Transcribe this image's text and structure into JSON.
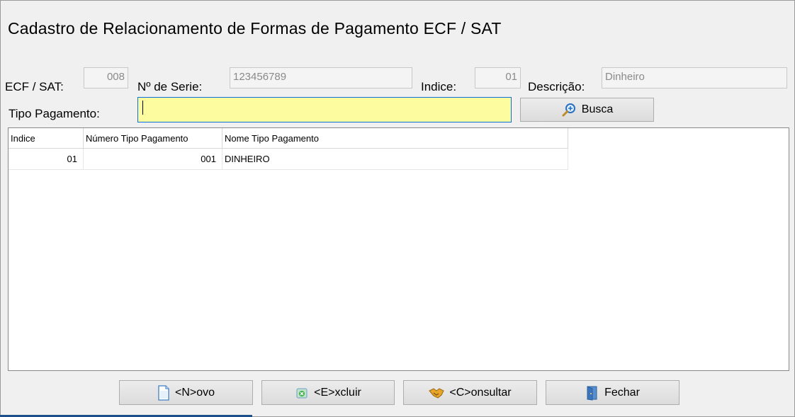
{
  "window": {
    "title": "Cadastro de Relacionamento de Formas de Pagamento ECF / SAT"
  },
  "fields": {
    "ecf_label": "ECF / SAT:",
    "ecf_value": "008",
    "serie_label": "Nº de Serie:",
    "serie_value": "123456789",
    "indice_label": "Indice:",
    "indice_value": "01",
    "descricao_label": "Descrição:",
    "descricao_value": "Dinheiro",
    "tipo_label": "Tipo Pagamento:",
    "tipo_value": ""
  },
  "search_button": {
    "label": "Busca",
    "icon": "magnifier-plus-icon"
  },
  "grid": {
    "columns": [
      "Indice",
      "Número Tipo Pagamento",
      "Nome Tipo Pagamento"
    ],
    "rows": [
      [
        "01",
        "001",
        "DINHEIRO"
      ]
    ]
  },
  "buttons": {
    "novo": {
      "label": "<N>ovo",
      "icon": "new-document-icon"
    },
    "excluir": {
      "label": "<E>xcluir",
      "icon": "delete-icon"
    },
    "consultar": {
      "label": "<C>onsultar",
      "icon": "handshake-icon"
    },
    "fechar": {
      "label": "Fechar",
      "icon": "exit-door-icon"
    }
  },
  "colors": {
    "input_highlight": "#fdfda0",
    "focus_border": "#0a6fd8"
  }
}
